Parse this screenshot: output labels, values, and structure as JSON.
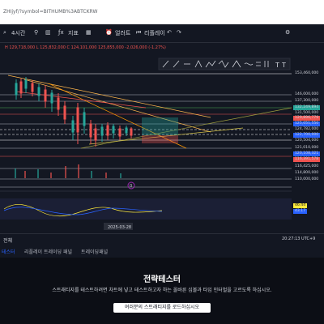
{
  "browser": {
    "url": "ZHIjyf/?symbol=BITHUMB%3ABTCKRW"
  },
  "toolbar": {
    "interval": "4시간",
    "indicators": "지표",
    "alert": "얼러트",
    "replay": "리플레이"
  },
  "chart": {
    "ohlc_info": "H 129,718,000  L 125,832,000  C 124,101,000  125,855,000  -2,026,000 (-1.27%)",
    "price_labels": [
      "153,460,000",
      "146,000,000",
      "137,300,000",
      "132,249,894",
      "131,500,000",
      "129,896,779",
      "125,051,550",
      "124,782,000",
      "122,700,000",
      "120,504,000",
      "121,010,000",
      "120,108,321",
      "116,391,578",
      "116,425,000",
      "114,800,000",
      "110,000,000"
    ],
    "date_label": "2025-03-28",
    "osc_labels": [
      "46.44",
      "43.17"
    ],
    "indicator_badge": "0"
  },
  "bottom_bar": {
    "left": "전체",
    "time": "20:27:13 UTC+9"
  },
  "tabs": [
    "테스터",
    "리플레이 트레이딩 패널",
    "트레이딩패널"
  ],
  "panel": {
    "title": "전략테스터",
    "description": "스트래티지를 테스트하려면 차트에 넣고 테스트하고자 하는 올바른 심볼과 타임 인터벌을 고르도록 하십시오.",
    "button": "여러분의 스트래티지를 로드하십시오"
  },
  "colors": {
    "up": "#26a69a",
    "down": "#ef5350",
    "background": "#131722"
  }
}
